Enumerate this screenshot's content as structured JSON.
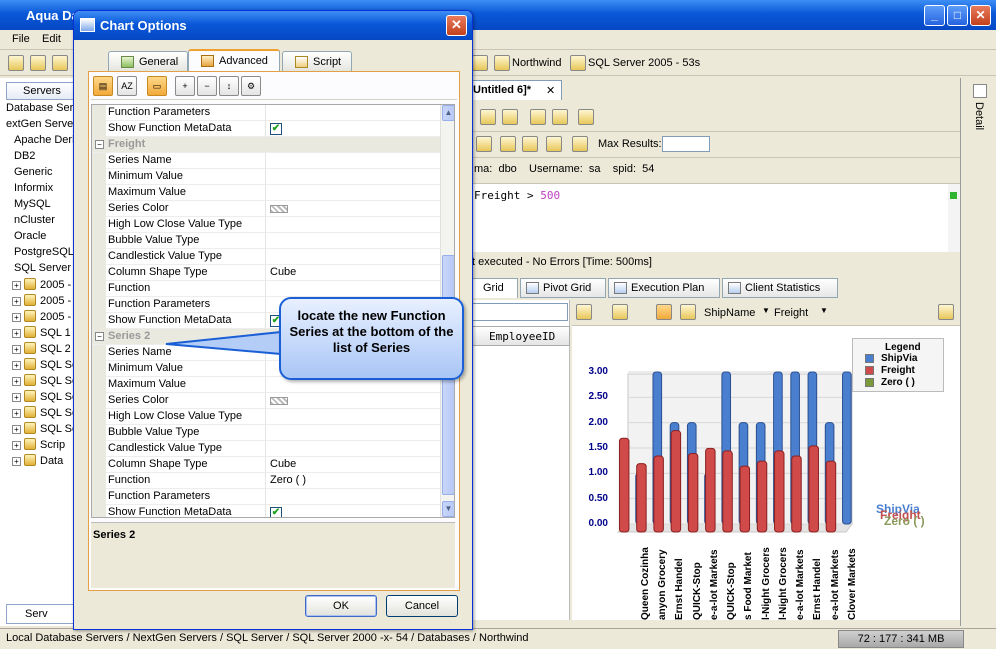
{
  "app": {
    "title": "Aqua Da"
  },
  "menu": [
    "File",
    "Edit"
  ],
  "connections": [
    "Northwind",
    "SQL Server 2005 - 53s"
  ],
  "left_panel": {
    "tab": "Servers",
    "items": [
      "Database Serv",
      "extGen Server",
      "Apache Derb",
      "DB2",
      "Generic",
      "Informix",
      "MySQL",
      "nCluster",
      "Oracle",
      "PostgreSQL",
      "SQL Server",
      "2005 - N",
      "2005 - S",
      "2005 - V",
      "SQL 1",
      "SQL 2",
      "SQL Serv",
      "SQL Serv",
      "SQL Serv",
      "SQL Serv",
      "SQL Serv",
      "Scrip",
      "Data"
    ],
    "bottom_tab": "Serv"
  },
  "editor": {
    "tab": "Untitled 6]*",
    "max_results_label": "Max Results:",
    "info": "ma:  dbo    Username:  sa    spid:  54",
    "sql_prefix": "Freight > ",
    "sql_value": "500",
    "status": "t executed - No Errors [Time: 500ms]"
  },
  "result_tabs": [
    "Grid",
    "Pivot Grid",
    "Execution Plan",
    "Client Statistics"
  ],
  "grid": {
    "column": "EmployeeID"
  },
  "chart_toolbar": {
    "field1": "ShipName",
    "field2": "Freight"
  },
  "chart_data": {
    "type": "bar",
    "title": "",
    "legend_title": "Legend",
    "legend_position": "top-right",
    "categories": [
      "Queen Cozinha",
      "anyon Grocery",
      "Ernst Handel",
      "QUICK-Stop",
      "e-a-lot Markets",
      "QUICK-Stop",
      "s Food Market",
      "l-Night Grocers",
      "l-Night Grocers",
      "e-a-lot Markets",
      "Ernst Handel",
      "e-a-lot Markets",
      "Clover Markets"
    ],
    "series": [
      {
        "name": "ShipVia",
        "color": "#4a7fd0",
        "values": [
          1,
          3,
          2,
          2,
          1,
          3,
          2,
          2,
          3,
          3,
          3,
          2,
          3
        ]
      },
      {
        "name": "Freight",
        "color": "#d04a4a",
        "values": [
          1.85,
          1.35,
          1.5,
          2.0,
          1.55,
          1.65,
          1.6,
          1.3,
          1.4,
          1.6,
          1.5,
          1.7,
          1.4
        ]
      },
      {
        "name": "Zero ( )",
        "color": "#7a9a3a",
        "values": [
          0,
          0,
          0,
          0,
          0,
          0,
          0,
          0,
          0,
          0,
          0,
          0,
          0
        ]
      }
    ],
    "ylim": [
      0,
      3
    ],
    "yticks": [
      "3.00",
      "2.50",
      "2.00",
      "1.50",
      "1.00",
      "0.50",
      "0.00"
    ],
    "side_labels": [
      "ShipVia",
      "Freight",
      "Zero ( )"
    ]
  },
  "statusbar": {
    "path": "Local Database Servers / NextGen Servers / SQL Server / SQL Server 2000 -x- 54 / Databases / Northwind",
    "memory": "72 : 177 : 341 MB"
  },
  "dialog": {
    "title": "Chart Options",
    "tabs": [
      "General",
      "Advanced",
      "Script"
    ],
    "rows": [
      {
        "label": "Function Parameters",
        "value": ""
      },
      {
        "label": "Show Function MetaData",
        "checked": true
      },
      {
        "category": "Freight"
      },
      {
        "label": "Series Name",
        "value": ""
      },
      {
        "label": "Minimum Value",
        "value": ""
      },
      {
        "label": "Maximum Value",
        "value": ""
      },
      {
        "label": "Series Color",
        "swatch": true
      },
      {
        "label": "High Low Close Value Type",
        "value": ""
      },
      {
        "label": "Bubble Value Type",
        "value": ""
      },
      {
        "label": "Candlestick Value Type",
        "value": ""
      },
      {
        "label": "Column Shape Type",
        "value": "Cube"
      },
      {
        "label": "Function",
        "value": ""
      },
      {
        "label": "Function Parameters",
        "value": ""
      },
      {
        "label": "Show Function MetaData",
        "checked": true
      },
      {
        "category": "Series 2"
      },
      {
        "label": "Series Name",
        "value": ""
      },
      {
        "label": "Minimum Value",
        "value": ""
      },
      {
        "label": "Maximum Value",
        "value": ""
      },
      {
        "label": "Series Color",
        "swatch": true
      },
      {
        "label": "High Low Close Value Type",
        "value": ""
      },
      {
        "label": "Bubble Value Type",
        "value": ""
      },
      {
        "label": "Candlestick Value Type",
        "value": ""
      },
      {
        "label": "Column Shape Type",
        "value": "Cube"
      },
      {
        "label": "Function",
        "value": "Zero ( )"
      },
      {
        "label": "Function Parameters",
        "value": ""
      },
      {
        "label": "Show Function MetaData",
        "checked": true
      }
    ],
    "description": "Series 2",
    "ok": "OK",
    "cancel": "Cancel"
  },
  "callout": "locate the new Function Series at the bottom of the list of Series"
}
